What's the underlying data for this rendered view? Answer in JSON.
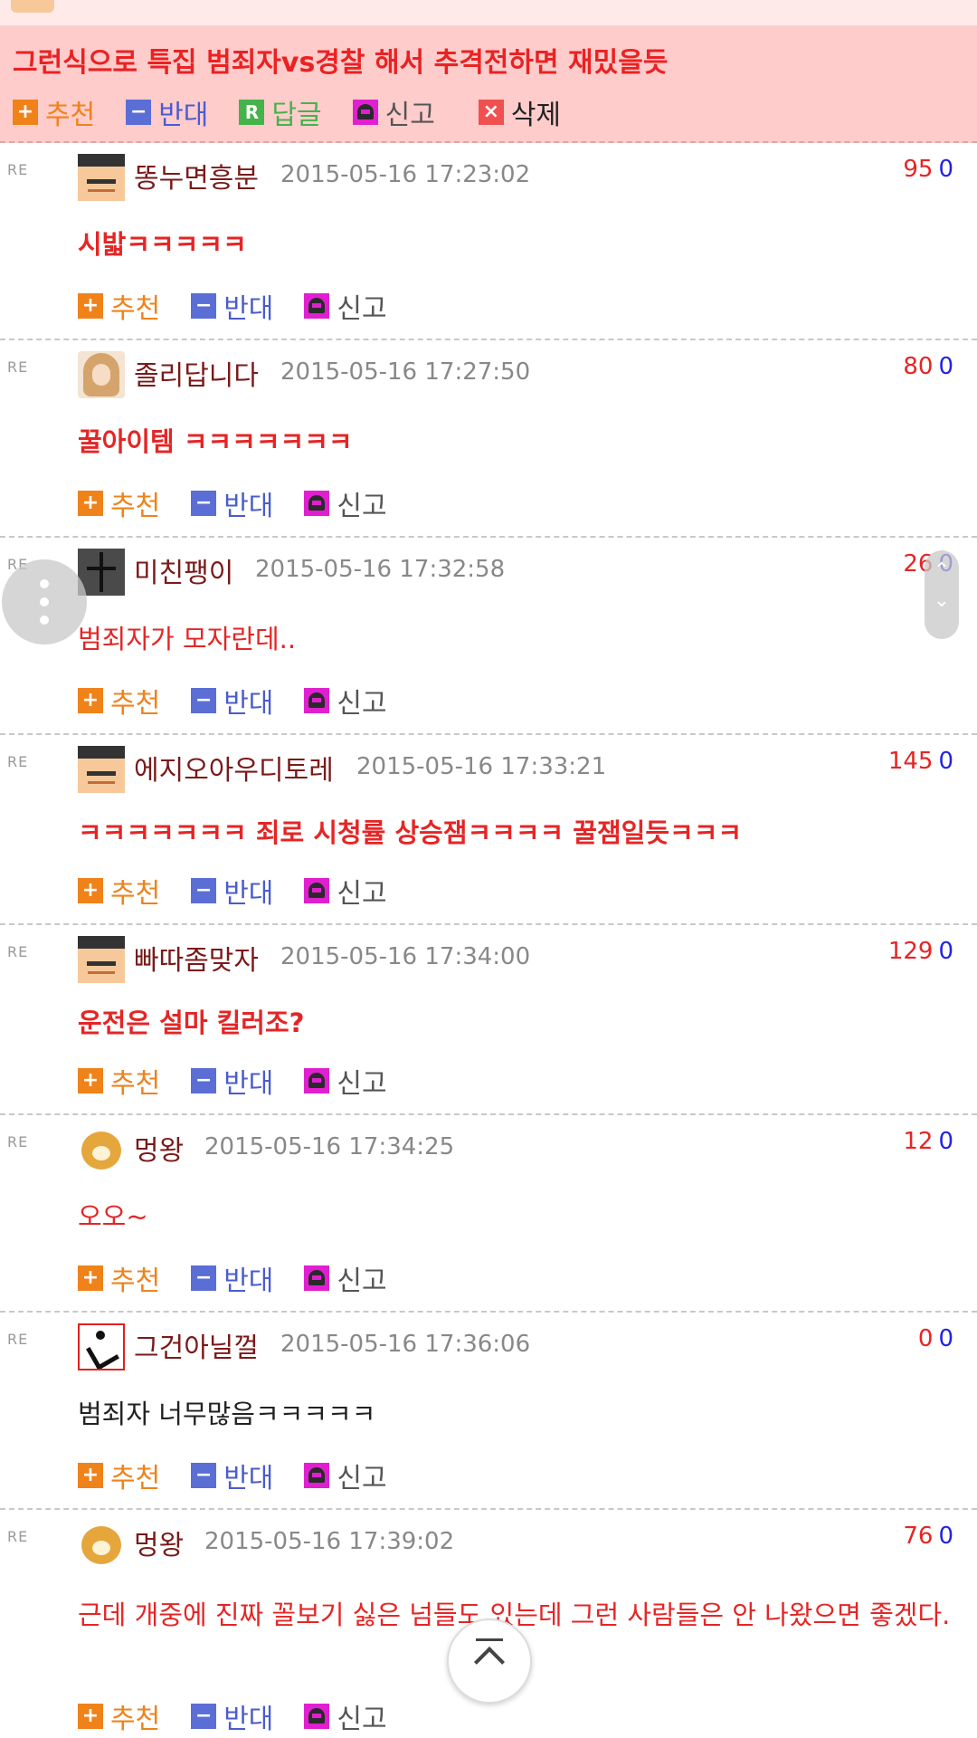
{
  "highlight": {
    "text": "그런식으로 특집 범죄자vs경찰 해서 추격전하면 재밌을듯",
    "actions": {
      "recommend": "추천",
      "oppose": "반대",
      "reply": "답글",
      "report": "신고",
      "delete": "삭제"
    },
    "icons": {
      "reply": "R",
      "delete": "×"
    }
  },
  "actions": {
    "recommend": "추천",
    "oppose": "반대",
    "report": "신고"
  },
  "icons": {
    "plus": "+",
    "minus": "−",
    "reply_mark": "RE"
  },
  "comments": [
    {
      "nick": "똥누면흥분",
      "date": "2015-05-16 17:23:02",
      "up": "95",
      "down": "0",
      "text": "시밟ㅋㅋㅋㅋㅋ",
      "avatar": "student-icon"
    },
    {
      "nick": "졸리답니다",
      "date": "2015-05-16 17:27:50",
      "up": "80",
      "down": "0",
      "text": "꿀아이템 ㅋㅋㅋㅋㅋㅋㅋ",
      "avatar": "girl-photo-icon"
    },
    {
      "nick": "미친팽이",
      "date": "2015-05-16 17:32:58",
      "up": "26",
      "down": "0",
      "text": "범죄자가 모자란데..",
      "avatar": "spinning-top-icon"
    },
    {
      "nick": "에지오아우디토레",
      "date": "2015-05-16 17:33:21",
      "up": "145",
      "down": "0",
      "text": "ㅋㅋㅋㅋㅋㅋㅋ 죄로 시청률 상승잼ㅋㅋㅋㅋ 꿀잼일듯ㅋㅋㅋ",
      "avatar": "student-icon"
    },
    {
      "nick": "빠따좀맞자",
      "date": "2015-05-16 17:34:00",
      "up": "129",
      "down": "0",
      "text": "운전은 설마 킬러조?",
      "avatar": "student-icon"
    },
    {
      "nick": "멍왕",
      "date": "2015-05-16 17:34:25",
      "up": "12",
      "down": "0",
      "text": "오오~",
      "avatar": "dog-icon"
    },
    {
      "nick": "그건아닐껄",
      "date": "2015-05-16 17:36:06",
      "up": "0",
      "down": "0",
      "text": "범죄자 너무많음ㅋㅋㅋㅋㅋ",
      "avatar": "runner-icon"
    },
    {
      "nick": "멍왕",
      "date": "2015-05-16 17:39:02",
      "up": "76",
      "down": "0",
      "text": "근데 개중에 진짜 꼴보기 싫은 넘들도 있는데 그런 사람들은 안 나왔으면 좋겠다.",
      "avatar": "dog-icon"
    }
  ]
}
